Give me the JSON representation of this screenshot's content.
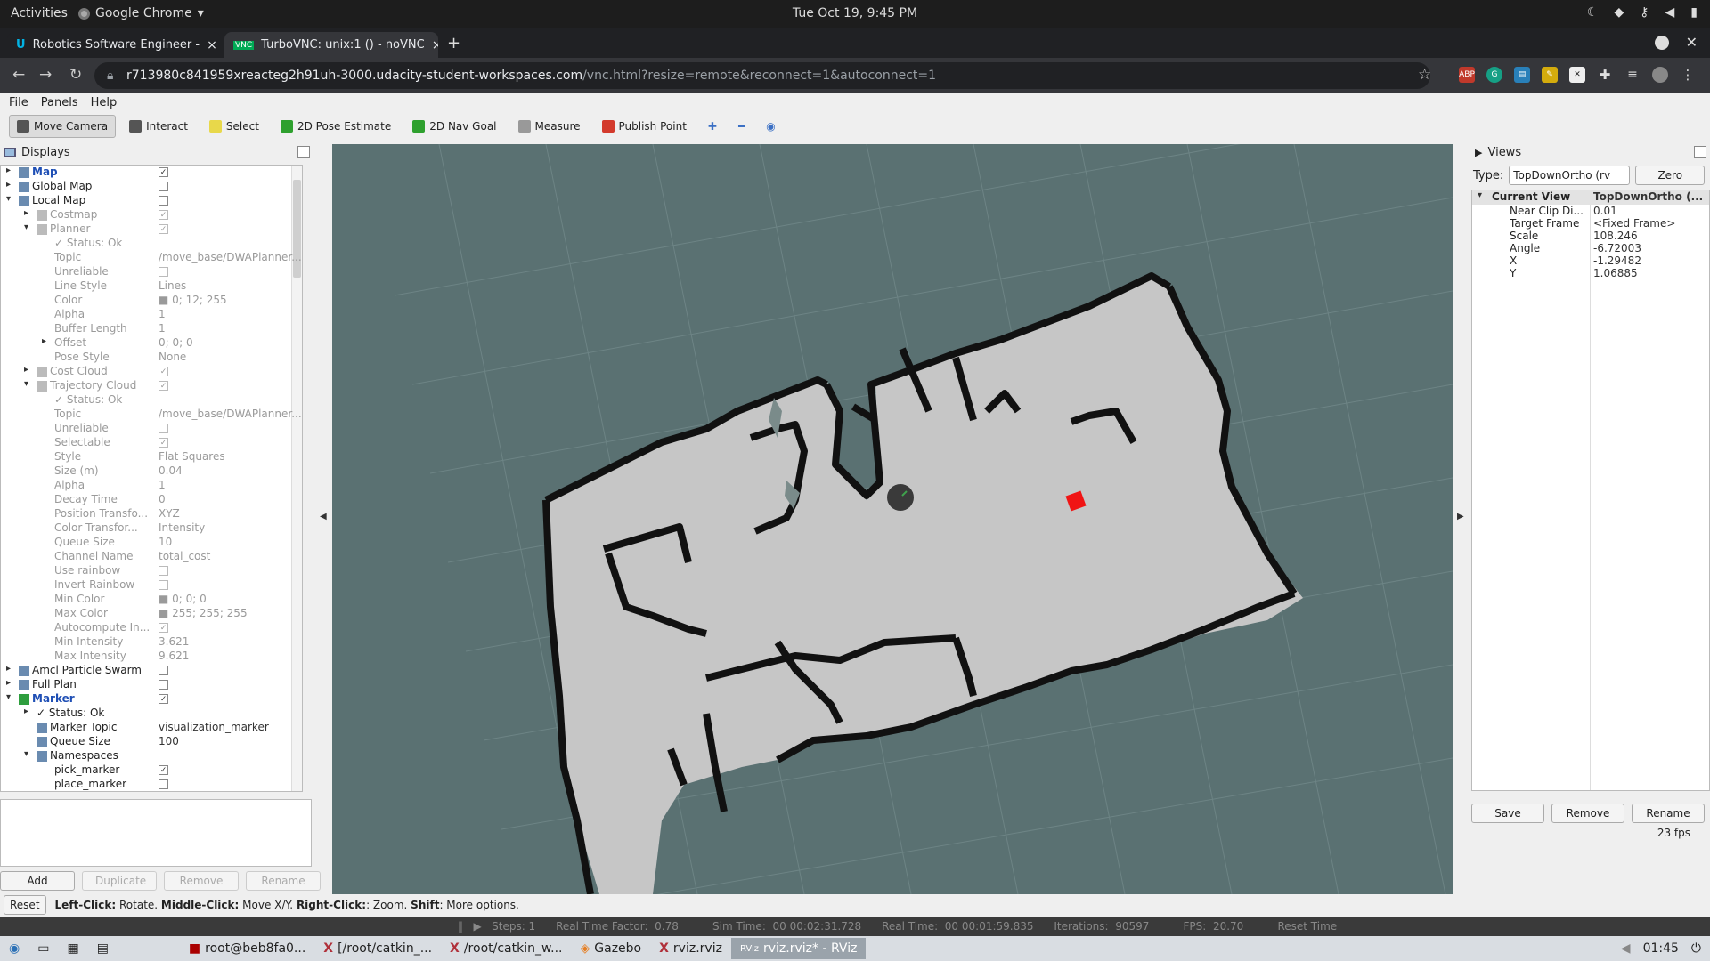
{
  "gnome": {
    "activities": "Activities",
    "app_name": "Google Chrome",
    "clock": "Tue Oct 19,  9:45 PM"
  },
  "tabs": [
    {
      "title": "Robotics Software Engineer -",
      "close": "×"
    },
    {
      "title": "TurboVNC: unix:1 () - noVNC",
      "close": "×"
    }
  ],
  "newtab": "+",
  "address": {
    "host": "r713980c841959xreacteg2h91uh-3000.udacity-student-workspaces.com",
    "path": "/vnc.html?resize=remote&reconnect=1&autoconnect=1"
  },
  "rviz": {
    "menu": [
      "File",
      "Panels",
      "Help"
    ],
    "tools": [
      {
        "label": "Move Camera",
        "icon": "move-camera-icon",
        "color": "#555555"
      },
      {
        "label": "Interact",
        "icon": "hand-icon",
        "color": "#555555"
      },
      {
        "label": "Select",
        "icon": "select-icon",
        "color": "#e8d84a"
      },
      {
        "label": "2D Pose Estimate",
        "icon": "green-arrow-icon",
        "color": "#2ea02e"
      },
      {
        "label": "2D Nav Goal",
        "icon": "green-arrow-icon",
        "color": "#2ea02e"
      },
      {
        "label": "Measure",
        "icon": "ruler-icon",
        "color": "#999999"
      },
      {
        "label": "Publish Point",
        "icon": "pin-icon",
        "color": "#d33a2c"
      }
    ],
    "displays_title": "Displays",
    "views_title": "Views",
    "displays": [
      {
        "indent": 0,
        "arrow": "▸",
        "name": "Map",
        "value": "✓",
        "kind": "cb",
        "bold": true,
        "dim": false
      },
      {
        "indent": 0,
        "arrow": "▸",
        "name": "Global Map",
        "value": "",
        "kind": "cb",
        "bold": false,
        "dim": false
      },
      {
        "indent": 0,
        "arrow": "▾",
        "name": "Local Map",
        "value": "",
        "kind": "cb",
        "bold": false,
        "dim": false
      },
      {
        "indent": 1,
        "arrow": "▸",
        "name": "Costmap",
        "value": "✓",
        "kind": "cb",
        "bold": false,
        "dim": true
      },
      {
        "indent": 1,
        "arrow": "▾",
        "name": "Planner",
        "value": "✓",
        "kind": "cb",
        "bold": false,
        "dim": true
      },
      {
        "indent": 2,
        "arrow": "",
        "name": "✓ Status: Ok",
        "value": "",
        "kind": "text",
        "bold": false,
        "dim": true
      },
      {
        "indent": 2,
        "arrow": "",
        "name": "Topic",
        "value": "/move_base/DWAPlanner...",
        "kind": "text",
        "bold": false,
        "dim": true
      },
      {
        "indent": 2,
        "arrow": "",
        "name": "Unreliable",
        "value": "",
        "kind": "cb",
        "bold": false,
        "dim": true
      },
      {
        "indent": 2,
        "arrow": "",
        "name": "Line Style",
        "value": "Lines",
        "kind": "text",
        "bold": false,
        "dim": true
      },
      {
        "indent": 2,
        "arrow": "",
        "name": "Color",
        "value": "■ 0; 12; 255",
        "kind": "text",
        "bold": false,
        "dim": true
      },
      {
        "indent": 2,
        "arrow": "",
        "name": "Alpha",
        "value": "1",
        "kind": "text",
        "bold": false,
        "dim": true
      },
      {
        "indent": 2,
        "arrow": "",
        "name": "Buffer Length",
        "value": "1",
        "kind": "text",
        "bold": false,
        "dim": true
      },
      {
        "indent": 2,
        "arrow": "▸",
        "name": "Offset",
        "value": "0; 0; 0",
        "kind": "text",
        "bold": false,
        "dim": true
      },
      {
        "indent": 2,
        "arrow": "",
        "name": "Pose Style",
        "value": "None",
        "kind": "text",
        "bold": false,
        "dim": true
      },
      {
        "indent": 1,
        "arrow": "▸",
        "name": "Cost Cloud",
        "value": "✓",
        "kind": "cb",
        "bold": false,
        "dim": true
      },
      {
        "indent": 1,
        "arrow": "▾",
        "name": "Trajectory Cloud",
        "value": "✓",
        "kind": "cb",
        "bold": false,
        "dim": true
      },
      {
        "indent": 2,
        "arrow": "",
        "name": "✓ Status: Ok",
        "value": "",
        "kind": "text",
        "bold": false,
        "dim": true
      },
      {
        "indent": 2,
        "arrow": "",
        "name": "Topic",
        "value": "/move_base/DWAPlanner...",
        "kind": "text",
        "bold": false,
        "dim": true
      },
      {
        "indent": 2,
        "arrow": "",
        "name": "Unreliable",
        "value": "",
        "kind": "cb",
        "bold": false,
        "dim": true
      },
      {
        "indent": 2,
        "arrow": "",
        "name": "Selectable",
        "value": "✓",
        "kind": "cb",
        "bold": false,
        "dim": true
      },
      {
        "indent": 2,
        "arrow": "",
        "name": "Style",
        "value": "Flat Squares",
        "kind": "text",
        "bold": false,
        "dim": true
      },
      {
        "indent": 2,
        "arrow": "",
        "name": "Size (m)",
        "value": "0.04",
        "kind": "text",
        "bold": false,
        "dim": true
      },
      {
        "indent": 2,
        "arrow": "",
        "name": "Alpha",
        "value": "1",
        "kind": "text",
        "bold": false,
        "dim": true
      },
      {
        "indent": 2,
        "arrow": "",
        "name": "Decay Time",
        "value": "0",
        "kind": "text",
        "bold": false,
        "dim": true
      },
      {
        "indent": 2,
        "arrow": "",
        "name": "Position Transfo...",
        "value": "XYZ",
        "kind": "text",
        "bold": false,
        "dim": true
      },
      {
        "indent": 2,
        "arrow": "",
        "name": "Color Transfor...",
        "value": "Intensity",
        "kind": "text",
        "bold": false,
        "dim": true
      },
      {
        "indent": 2,
        "arrow": "",
        "name": "Queue Size",
        "value": "10",
        "kind": "text",
        "bold": false,
        "dim": true
      },
      {
        "indent": 2,
        "arrow": "",
        "name": "Channel Name",
        "value": "total_cost",
        "kind": "text",
        "bold": false,
        "dim": true
      },
      {
        "indent": 2,
        "arrow": "",
        "name": "Use rainbow",
        "value": "",
        "kind": "cb",
        "bold": false,
        "dim": true
      },
      {
        "indent": 2,
        "arrow": "",
        "name": "Invert Rainbow",
        "value": "",
        "kind": "cb",
        "bold": false,
        "dim": true
      },
      {
        "indent": 2,
        "arrow": "",
        "name": "Min Color",
        "value": "■ 0; 0; 0",
        "kind": "text",
        "bold": false,
        "dim": true
      },
      {
        "indent": 2,
        "arrow": "",
        "name": "Max Color",
        "value": "■ 255; 255; 255",
        "kind": "text",
        "bold": false,
        "dim": true
      },
      {
        "indent": 2,
        "arrow": "",
        "name": "Autocompute In...",
        "value": "✓",
        "kind": "cb",
        "bold": false,
        "dim": true
      },
      {
        "indent": 2,
        "arrow": "",
        "name": "Min Intensity",
        "value": "3.621",
        "kind": "text",
        "bold": false,
        "dim": true
      },
      {
        "indent": 2,
        "arrow": "",
        "name": "Max Intensity",
        "value": "9.621",
        "kind": "text",
        "bold": false,
        "dim": true
      },
      {
        "indent": 0,
        "arrow": "▸",
        "name": "Amcl Particle Swarm",
        "value": "",
        "kind": "cb",
        "bold": false,
        "dim": false
      },
      {
        "indent": 0,
        "arrow": "▸",
        "name": "Full Plan",
        "value": "",
        "kind": "cb",
        "bold": false,
        "dim": false
      },
      {
        "indent": 0,
        "arrow": "▾",
        "name": "Marker",
        "value": "✓",
        "kind": "cb",
        "bold": true,
        "dim": false
      },
      {
        "indent": 1,
        "arrow": "▸",
        "name": "✓ Status: Ok",
        "value": "",
        "kind": "text",
        "bold": false,
        "dim": false
      },
      {
        "indent": 1,
        "arrow": "",
        "name": "Marker Topic",
        "value": "visualization_marker",
        "kind": "text",
        "bold": false,
        "dim": false
      },
      {
        "indent": 1,
        "arrow": "",
        "name": "Queue Size",
        "value": "100",
        "kind": "text",
        "bold": false,
        "dim": false
      },
      {
        "indent": 1,
        "arrow": "▾",
        "name": "Namespaces",
        "value": "",
        "kind": "text",
        "bold": false,
        "dim": false
      },
      {
        "indent": 2,
        "arrow": "",
        "name": "pick_marker",
        "value": "✓",
        "kind": "cb",
        "bold": false,
        "dim": false
      },
      {
        "indent": 2,
        "arrow": "",
        "name": "place_marker",
        "value": "",
        "kind": "cb",
        "bold": false,
        "dim": false
      }
    ],
    "left_buttons": [
      {
        "label": "Add",
        "enabled": true
      },
      {
        "label": "Duplicate",
        "enabled": false
      },
      {
        "label": "Remove",
        "enabled": false
      },
      {
        "label": "Rename",
        "enabled": false
      }
    ],
    "views": {
      "type_label": "Type:",
      "type_value": "TopDownOrtho (rv",
      "zero_label": "Zero",
      "header_name": "Current View",
      "header_value": "TopDownOrtho (...",
      "props": [
        {
          "name": "Near Clip Di...",
          "value": "0.01"
        },
        {
          "name": "Target Frame",
          "value": "<Fixed Frame>"
        },
        {
          "name": "Scale",
          "value": "108.246"
        },
        {
          "name": "Angle",
          "value": "-6.72003"
        },
        {
          "name": "X",
          "value": "-1.29482"
        },
        {
          "name": "Y",
          "value": "1.06885"
        }
      ],
      "buttons": [
        "Save",
        "Remove",
        "Rename"
      ],
      "fps": "23 fps"
    },
    "status": {
      "reset": "Reset",
      "lc": "Left-Click:",
      "lc_t": " Rotate. ",
      "mc": "Middle-Click:",
      "mc_t": " Move X/Y. ",
      "rc": "Right-Click:",
      "rc_t": ": Zoom. ",
      "sh": "Shift",
      "sh_t": ": More options."
    }
  },
  "gazebo_bar": "‖   ▶   Steps: 1      Real Time Factor:  0.78          Sim Time:  00 00:02:31.728      Real Time:  00 00:01:59.835      Iterations:  90597          FPS:  20.70          Reset Time",
  "taskbar": {
    "items": [
      "root@beb8fa0...",
      "[/root/catkin_...",
      "/root/catkin_w...",
      "Gazebo",
      "rviz.rviz",
      "rviz.rviz* - RViz"
    ],
    "time": "01:45"
  }
}
